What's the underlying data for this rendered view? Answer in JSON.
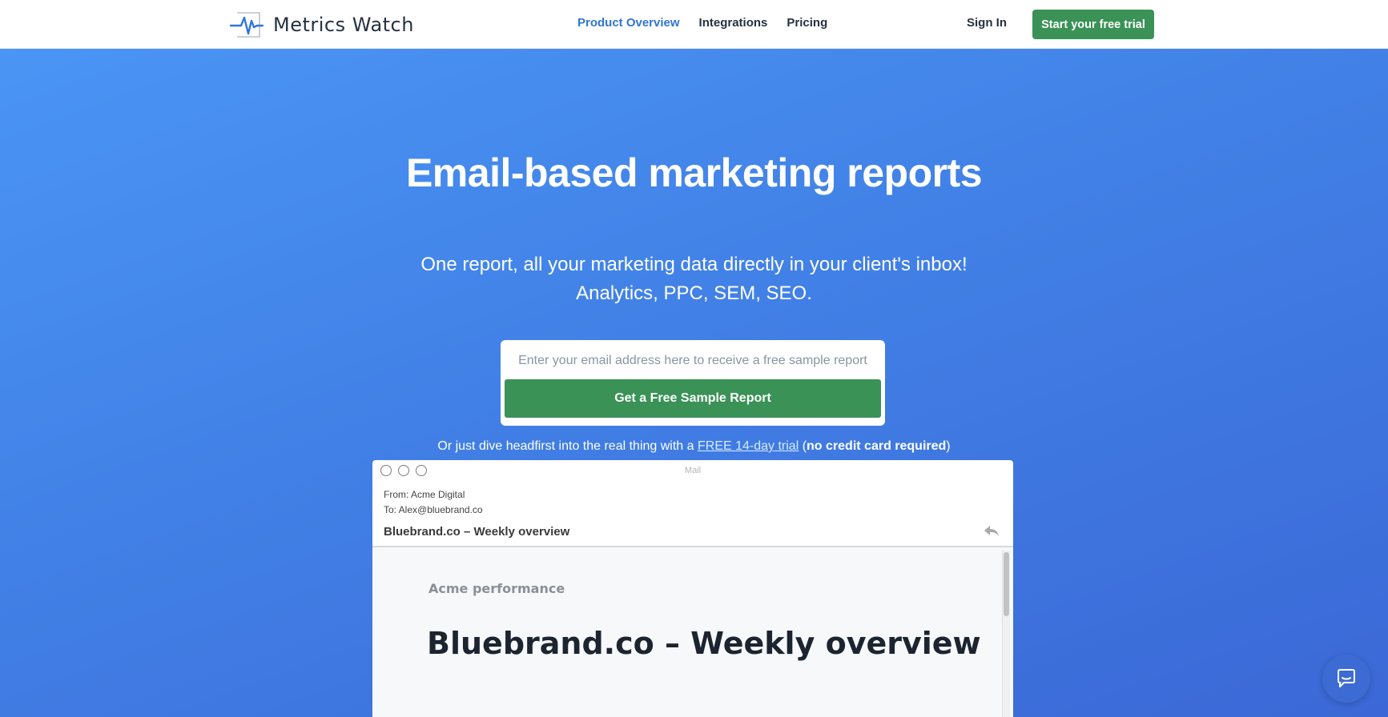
{
  "header": {
    "logo_text": "Metrics Watch",
    "nav": [
      {
        "label": "Product Overview",
        "active": true
      },
      {
        "label": "Integrations",
        "active": false
      },
      {
        "label": "Pricing",
        "active": false
      }
    ],
    "signin_label": "Sign In",
    "trial_button_label": "Start your free trial"
  },
  "hero": {
    "title": "Email-based marketing reports",
    "subtitle_line1": "One report, all your marketing data directly in your client's inbox!",
    "subtitle_line2": "Analytics, PPC, SEM, SEO.",
    "email_placeholder": "Enter your email address here to receive a free sample report",
    "sample_button_label": "Get a Free Sample Report",
    "trial_prefix": "Or just dive headfirst into the real thing with a ",
    "trial_link": "FREE 14-day trial",
    "trial_open": " (",
    "trial_bold": "no credit card required",
    "trial_close": ")"
  },
  "mail": {
    "window_title": "Mail",
    "from": "From: Acme Digital",
    "to": "To: Alex@bluebrand.co",
    "subject": "Bluebrand.co – Weekly overview",
    "body_label": "Acme performance",
    "body_heading": "Bluebrand.co – Weekly overview"
  },
  "icons": {
    "logo": "pulse-logo-icon",
    "reply": "reply-icon",
    "chat": "chat-bubble-icon"
  },
  "colors": {
    "accent_green": "#3a9257",
    "link_blue": "#2f76d6",
    "hero_gradient_start": "#4a95f5",
    "hero_gradient_end": "#3b68d6"
  }
}
